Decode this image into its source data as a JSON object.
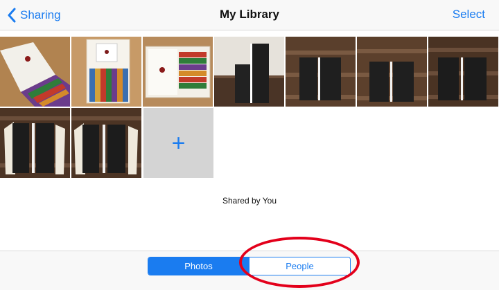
{
  "navbar": {
    "back_label": "Sharing",
    "title": "My Library",
    "select_label": "Select"
  },
  "grid": {
    "photos": [
      {
        "name": "photo-boxed-set-open"
      },
      {
        "name": "photo-box-with-card"
      },
      {
        "name": "photo-box-lid-open"
      },
      {
        "name": "photo-book-stacks-stairs"
      },
      {
        "name": "photo-book-stacks-stairs"
      },
      {
        "name": "photo-book-stacks-stairs"
      },
      {
        "name": "photo-book-stacks-stairs"
      },
      {
        "name": "photo-book-stacks-stairs"
      },
      {
        "name": "photo-book-stacks-stairs"
      }
    ],
    "add_symbol": "+"
  },
  "shared_label": "Shared by You",
  "segments": {
    "photos_label": "Photos",
    "people_label": "People",
    "selected": "Photos"
  },
  "colors": {
    "accent": "#1a7cf0",
    "annotation": "#e3001b",
    "tile_placeholder": "#d4d4d4"
  }
}
